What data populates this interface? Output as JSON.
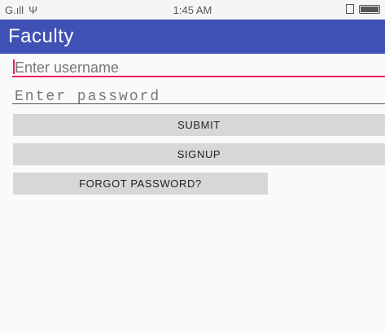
{
  "status_bar": {
    "carrier": "G.ıll",
    "usb_symbol": "Ψ",
    "time": "1:45 AM",
    "icons": [
      "vibrate-icon",
      "battery-icon"
    ]
  },
  "app_bar": {
    "title": "Faculty",
    "color": "#3f51b5"
  },
  "form": {
    "username_placeholder": "Enter username",
    "password_placeholder": "Enter password",
    "accent_color": "#e91e63"
  },
  "buttons": {
    "submit": "SUBMIT",
    "signup": "SIGNUP",
    "forgot": "FORGOT PASSWORD?"
  }
}
